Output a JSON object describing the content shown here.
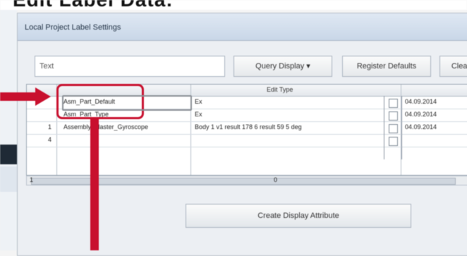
{
  "caption": {
    "text": "Edit Label Data:"
  },
  "window": {
    "title": "Local Project Label Settings"
  },
  "toolbar": {
    "filter_value": "Text",
    "query_label": "Query Display",
    "query_caret": "▾",
    "register_label": "Register Defaults",
    "clear_label": "Clear"
  },
  "grid": {
    "columns": [
      "",
      "Edit Type",
      ""
    ],
    "rows": [
      {
        "num": "",
        "name": "Asm_Part_Default",
        "value": "Ex",
        "date": "04.09.2014"
      },
      {
        "num": "",
        "name": "Asm_Part_Type",
        "value": "Ex",
        "date": "04.09.2014"
      },
      {
        "num": "1",
        "name": "Assembly_Master_Gyroscope",
        "value": "Body 1 v1 result 178 6 result 59 5 deg",
        "date": "04.09.2014"
      },
      {
        "num": "4",
        "name": "",
        "value": "",
        "date": ""
      }
    ]
  },
  "scroll": {
    "left_label": "1",
    "mid_label": "0"
  },
  "actions": {
    "create_label": "Create Display Attribute"
  },
  "colors": {
    "annotation": "#c8102e",
    "window_bg": "#eceff3"
  }
}
